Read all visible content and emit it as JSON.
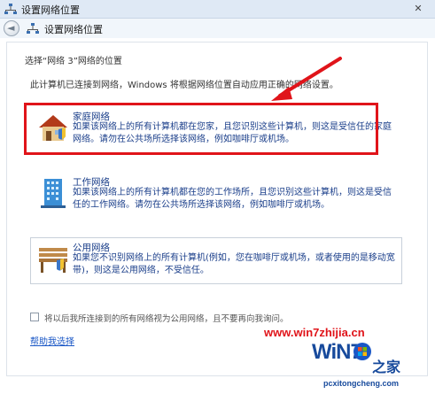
{
  "window": {
    "title": "设置网络位置",
    "close_symbol": "✕"
  },
  "nav": {
    "title": "设置网络位置"
  },
  "main": {
    "prompt": "选择“网络 3”网络的位置",
    "description": "此计算机已连接到网络，Windows 将根据网络位置自动应用正确的网络设置。",
    "options": [
      {
        "title": "家庭网络",
        "description": "如果该网络上的所有计算机都在您家，且您识别这些计算机，则这是受信任的家庭网络。请勿在公共场所选择该网络，例如咖啡厅或机场。",
        "icon": "home-network-icon"
      },
      {
        "title": "工作网络",
        "description": "如果该网络上的所有计算机都在您的工作场所，且您识别这些计算机，则这是受信任的工作网络。请勿在公共场所选择该网络，例如咖啡厅或机场。",
        "icon": "work-network-icon"
      },
      {
        "title": "公用网络",
        "description": "如果您不识别网络上的所有计算机(例如，您在咖啡厅或机场，或者使用的是移动宽带)，则这是公用网络，不受信任。",
        "icon": "public-network-icon"
      }
    ],
    "checkbox_label": "将以后我所连接到的所有网络视为公用网络，且不要再向我询问。",
    "help_link": "帮助我选择"
  },
  "watermark": {
    "url": "www.win7zhijia.cn",
    "logo_text": "WiN7",
    "logo_cn": "之家",
    "site": "pcxitongcheng.com"
  },
  "colors": {
    "link": "#1a3e8a",
    "highlight_border": "#e0141a",
    "arrow": "#e0141a"
  }
}
